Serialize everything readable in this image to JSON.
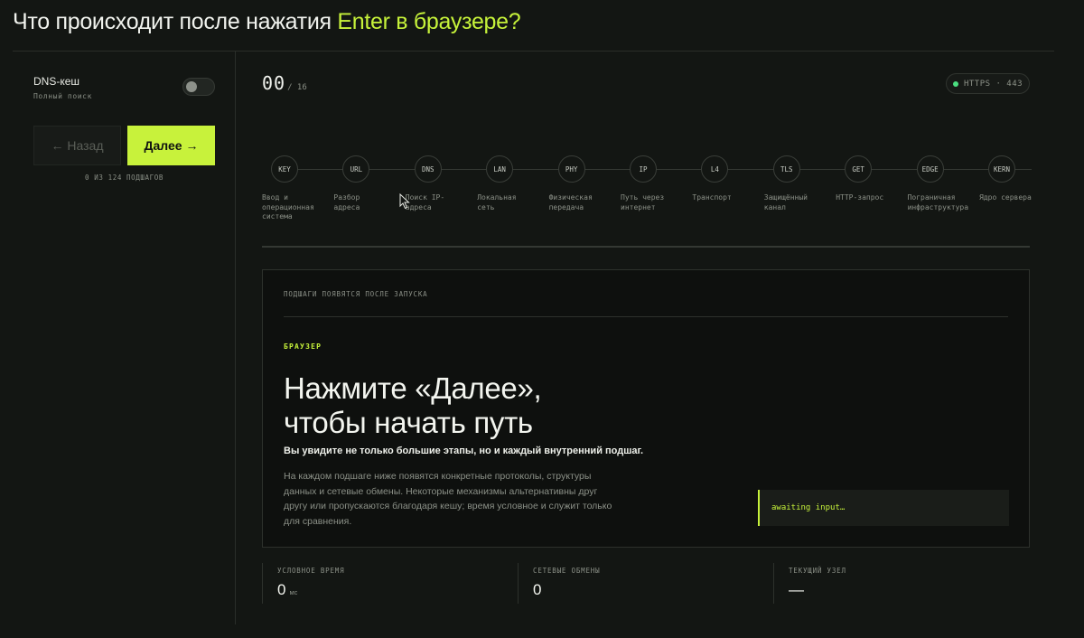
{
  "header": {
    "title_prefix": "Что происходит после нажатия ",
    "title_accent": "Enter в браузере?",
    "accent_color": "#c6f23a"
  },
  "sidebar": {
    "dns_cache_label": "DNS-кеш",
    "dns_cache_sub": "Полный поиск",
    "dns_cache_enabled": false,
    "back_label": "← Назад",
    "next_label": "Далее →",
    "substeps_count": "0 из 124 подшагов"
  },
  "progress": {
    "current": "00",
    "total": "/ 16"
  },
  "protocol": {
    "label": "HTTPS · 443",
    "indicator_color": "#4ade80"
  },
  "stages": [
    {
      "code": "KEY",
      "label": "Ввод и\nоперационная\nсистема"
    },
    {
      "code": "URL",
      "label": "Разбор\nадреса"
    },
    {
      "code": "DNS",
      "label": "Поиск IP-\nадреса"
    },
    {
      "code": "LAN",
      "label": "Локальная\nсеть"
    },
    {
      "code": "PHY",
      "label": "Физическая\nпередача"
    },
    {
      "code": "IP",
      "label": "Путь через\nинтернет"
    },
    {
      "code": "L4",
      "label": "Транспорт"
    },
    {
      "code": "TLS",
      "label": "Защищённый\nканал"
    },
    {
      "code": "GET",
      "label": "HTTP-запрос"
    },
    {
      "code": "EDGE",
      "label": "Пограничная\nинфраструктура"
    },
    {
      "code": "KERN",
      "label": "Ядро сервера"
    }
  ],
  "card": {
    "hint": "подшаги появятся после запуска",
    "category": "браузер",
    "heading": "Нажмите «Далее»,\nчтобы начать путь",
    "subheading": "Вы увидите не только большие этапы, но и каждый внутренний подшаг.",
    "body": "На каждом подшаге ниже появятся конкретные протоколы, структуры данных и сетевые обмены. Некоторые механизмы альтернативны друг другу или пропускаются благодаря кешу; время условное и служит только для сравнения.",
    "console_text": "awaiting input…"
  },
  "stats": {
    "time_label": "условное время",
    "time_value": "0",
    "time_unit": "мс",
    "exchanges_label": "сетевые обмены",
    "exchanges_value": "0",
    "node_label": "текущий узел",
    "node_value": "—"
  }
}
